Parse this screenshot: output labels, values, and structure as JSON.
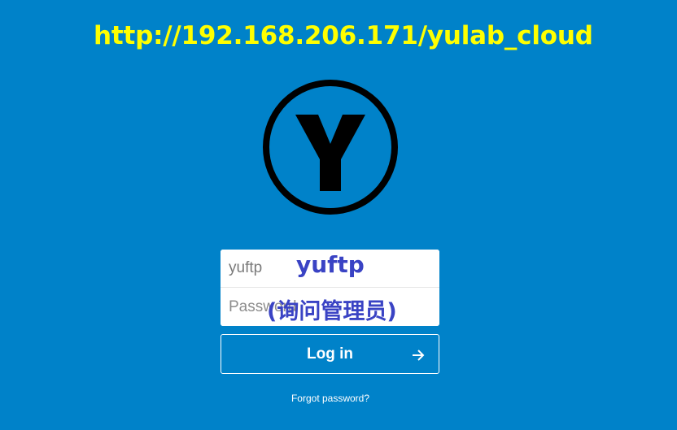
{
  "annotation": {
    "url": "http://192.168.206.171/yulab_cloud",
    "username_note": "yuftp",
    "role_note": "(询问管理员)"
  },
  "logo": {
    "letter": "Y",
    "icon": "y-circle-logo-icon"
  },
  "login": {
    "username_value": "yuftp",
    "password_placeholder": "Password",
    "button_label": "Log in",
    "button_icon": "arrow-right-icon",
    "forgot_link": "Forgot password?"
  },
  "colors": {
    "background": "#0082c9",
    "annotation_url": "#ffff00",
    "annotation_text": "#3a43c4",
    "logo": "#000000"
  }
}
